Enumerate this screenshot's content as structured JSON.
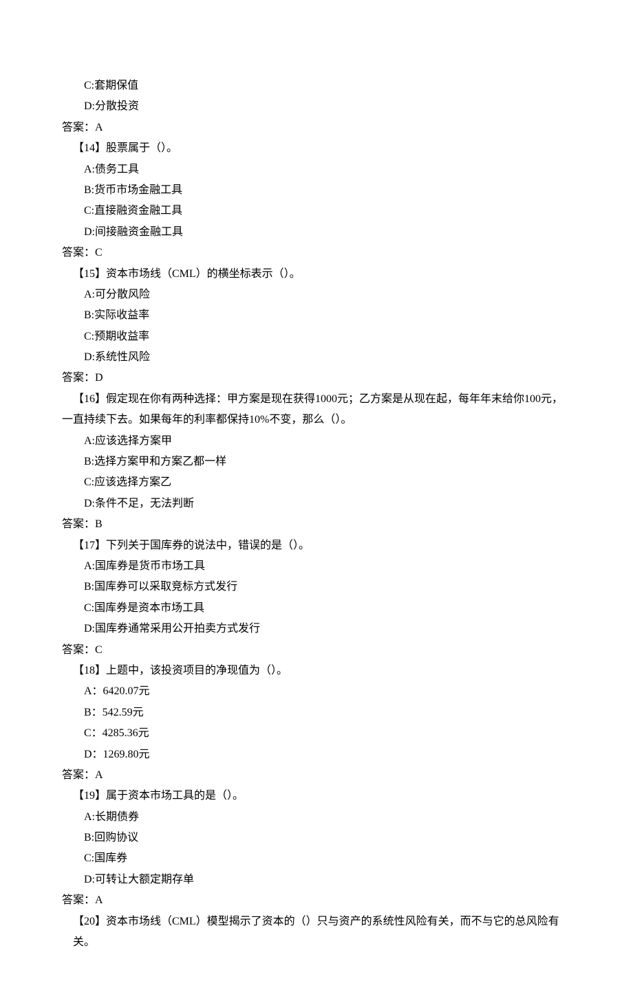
{
  "lines": {
    "opt_c": "C:套期保值",
    "opt_d": "D:分散投资",
    "ans13": "答案：A",
    "q14": "【14】股票属于（）。",
    "q14_a": "A:债务工具",
    "q14_b": "B:货币市场金融工具",
    "q14_c": "C:直接融资金融工具",
    "q14_d": "D:间接融资金融工具",
    "ans14": "答案：C",
    "q15": "【15】资本市场线（CML）的横坐标表示（）。",
    "q15_a": "A:可分散风险",
    "q15_b": "B:实际收益率",
    "q15_c": "C:预期收益率",
    "q15_d": "D:系统性风险",
    "ans15": "答案：D",
    "q16_l1": "【16】假定现在你有两种选择：甲方案是现在获得1000元；乙方案是从现在起，每年年末给你100元，",
    "q16_l2": "一直持续下去。如果每年的利率都保持10%不变，那么（）。",
    "q16_a": "A:应该选择方案甲",
    "q16_b": "B:选择方案甲和方案乙都一样",
    "q16_c": "C:应该选择方案乙",
    "q16_d": "D:条件不足，无法判断",
    "ans16": "答案：B",
    "q17": "【17】下列关于国库券的说法中，错误的是（）。",
    "q17_a": "A:国库券是货币市场工具",
    "q17_b": "B:国库券可以采取竞标方式发行",
    "q17_c": "C:国库券是资本市场工具",
    "q17_d": "D:国库券通常采用公开拍卖方式发行",
    "ans17": "答案：C",
    "q18": "【18】上题中，该投资项目的净现值为（）。",
    "q18_a": "A：6420.07元",
    "q18_b": "B：542.59元",
    "q18_c": "C：4285.36元",
    "q18_d": "D：1269.80元",
    "ans18": "答案：A",
    "q19": "【19】属于资本市场工具的是（）。",
    "q19_a": "A:长期债券",
    "q19_b": "B:回购协议",
    "q19_c": "C:国库券",
    "q19_d": "D:可转让大额定期存单",
    "ans19": "答案：A",
    "q20": "【20】资本市场线（CML）模型揭示了资本的（）只与资产的系统性风险有关，而不与它的总风险有关。"
  }
}
